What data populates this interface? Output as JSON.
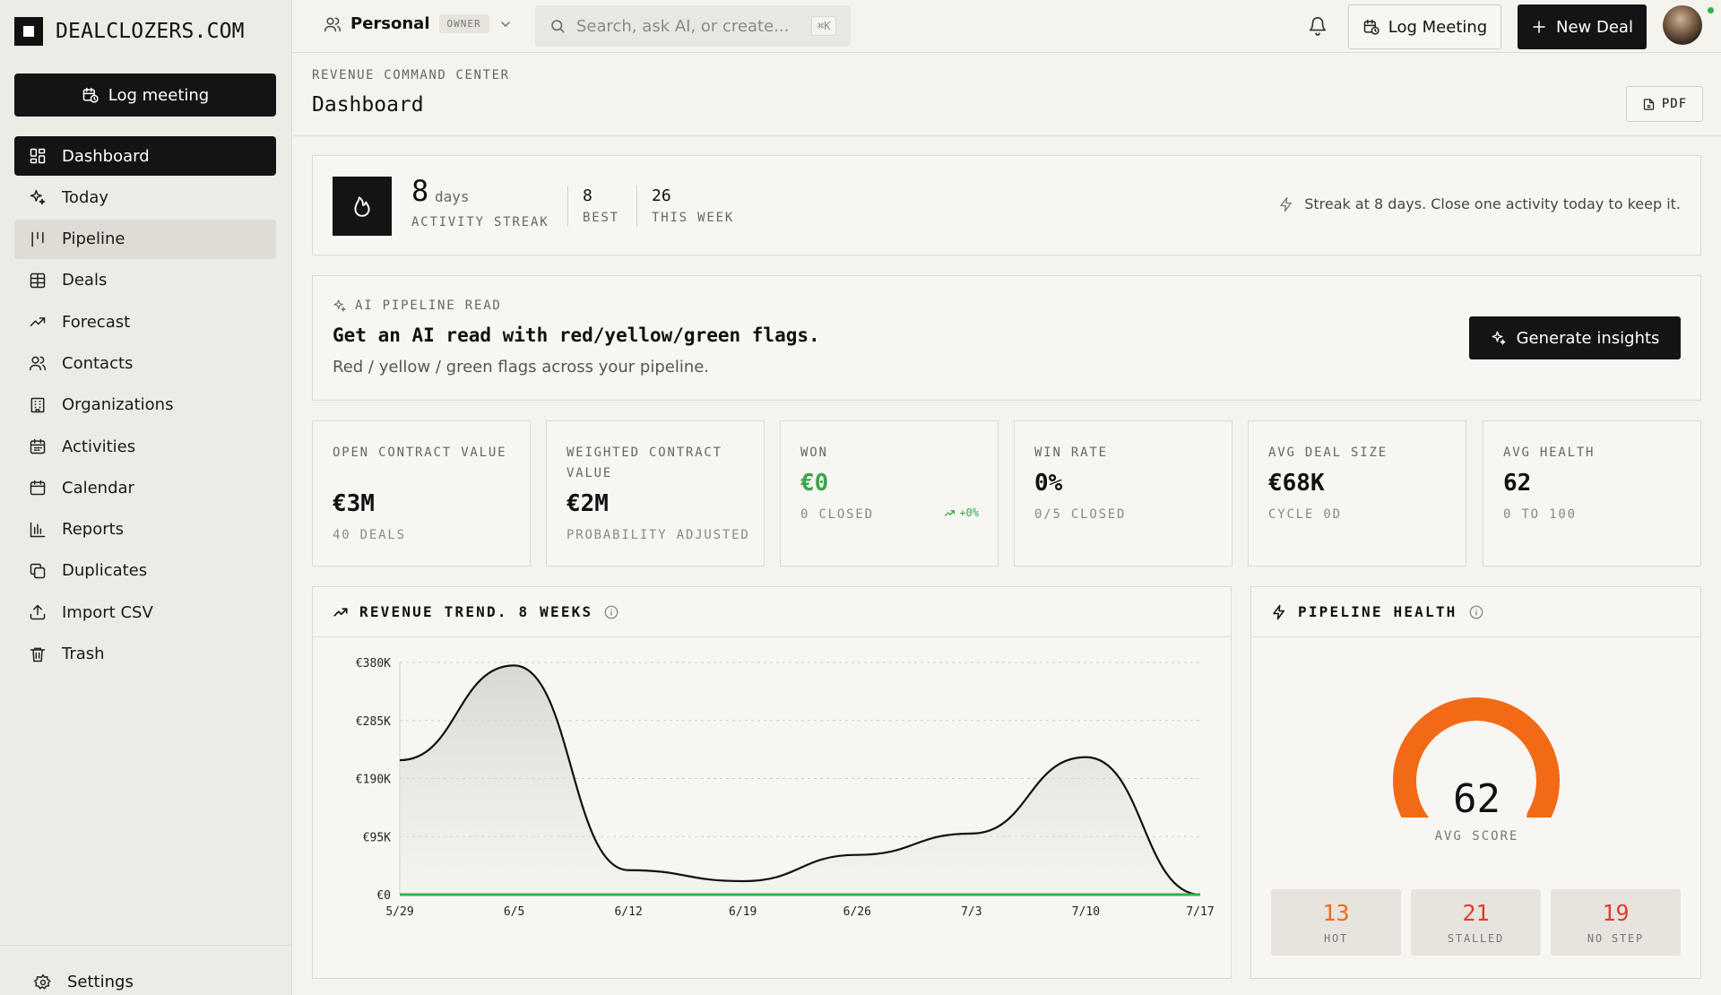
{
  "brand": {
    "name": "DEALCLOZERS.COM"
  },
  "sidebar": {
    "log_meeting": "Log meeting",
    "items": [
      {
        "label": "Dashboard",
        "icon": "dashboard-icon",
        "state": "active"
      },
      {
        "label": "Today",
        "icon": "sparkles-icon",
        "state": ""
      },
      {
        "label": "Pipeline",
        "icon": "pipeline-icon",
        "state": "hover"
      },
      {
        "label": "Deals",
        "icon": "table-icon",
        "state": ""
      },
      {
        "label": "Forecast",
        "icon": "trend-icon",
        "state": ""
      },
      {
        "label": "Contacts",
        "icon": "users-icon",
        "state": ""
      },
      {
        "label": "Organizations",
        "icon": "building-icon",
        "state": ""
      },
      {
        "label": "Activities",
        "icon": "calendar-check-icon",
        "state": ""
      },
      {
        "label": "Calendar",
        "icon": "calendar-icon",
        "state": ""
      },
      {
        "label": "Reports",
        "icon": "bar-chart-icon",
        "state": ""
      },
      {
        "label": "Duplicates",
        "icon": "copy-icon",
        "state": ""
      },
      {
        "label": "Import CSV",
        "icon": "upload-icon",
        "state": ""
      },
      {
        "label": "Trash",
        "icon": "trash-icon",
        "state": ""
      }
    ],
    "settings": "Settings"
  },
  "topbar": {
    "workspace": "Personal",
    "role": "OWNER",
    "search_placeholder": "Search, ask AI, or create...",
    "shortcut": "⌘K",
    "log_meeting": "Log Meeting",
    "new_deal": "New Deal"
  },
  "header": {
    "eyebrow": "REVENUE COMMAND CENTER",
    "title": "Dashboard",
    "pdf": "PDF"
  },
  "streak": {
    "days": "8",
    "unit": "days",
    "label": "ACTIVITY STREAK",
    "best": "8",
    "best_label": "BEST",
    "week": "26",
    "week_label": "THIS WEEK",
    "message": "Streak at 8 days. Close one activity today to keep it."
  },
  "ai": {
    "eyebrow": "AI PIPELINE READ",
    "title": "Get an AI read with red/yellow/green flags.",
    "subtitle": "Red / yellow / green flags across your pipeline.",
    "button": "Generate insights"
  },
  "kpis": [
    {
      "label": "OPEN CONTRACT VALUE",
      "value": "€3M",
      "sub": "40 DEALS"
    },
    {
      "label": "WEIGHTED CONTRACT VALUE",
      "value": "€2M",
      "sub": "PROBABILITY ADJUSTED"
    },
    {
      "label": "WON",
      "value": "€0",
      "sub": "0 CLOSED",
      "delta": "+0%"
    },
    {
      "label": "WIN RATE",
      "value": "0%",
      "sub": "0/5 CLOSED"
    },
    {
      "label": "AVG DEAL SIZE",
      "value": "€68K",
      "sub": "CYCLE 0D"
    },
    {
      "label": "AVG HEALTH",
      "value": "62",
      "sub": "0 TO 100"
    }
  ],
  "trend": {
    "title": "REVENUE TREND. 8 WEEKS"
  },
  "chart_data": {
    "type": "area",
    "title": "REVENUE TREND. 8 WEEKS",
    "categories": [
      "5/29",
      "6/5",
      "6/12",
      "6/19",
      "6/26",
      "7/3",
      "7/10",
      "7/17"
    ],
    "y_ticks": [
      "€0",
      "€95K",
      "€190K",
      "€285K",
      "€380K"
    ],
    "ylim": [
      0,
      380000
    ],
    "series": [
      {
        "values": [
          220000,
          375000,
          40000,
          22000,
          65000,
          100000,
          225000,
          0
        ]
      },
      {
        "values": [
          0,
          0,
          0,
          0,
          0,
          0,
          0,
          0
        ]
      }
    ],
    "grid": true
  },
  "health": {
    "title": "PIPELINE HEALTH",
    "score": "62",
    "score_label": "AVG SCORE",
    "gauge_fraction": 0.62,
    "color": "#f26a16",
    "stats": [
      {
        "value": "13",
        "label": "HOT",
        "color": "#f26a16"
      },
      {
        "value": "21",
        "label": "STALLED",
        "color": "#e43a2f"
      },
      {
        "value": "19",
        "label": "NO STEP",
        "color": "#e43a2f"
      }
    ]
  }
}
